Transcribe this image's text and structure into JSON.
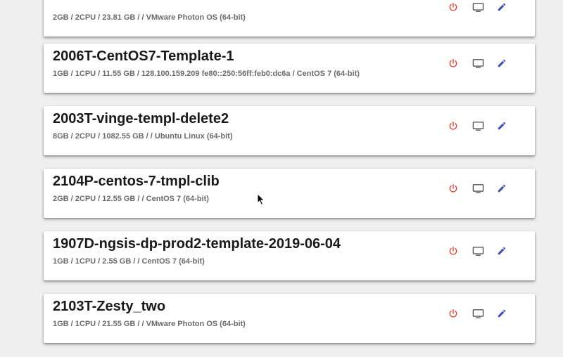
{
  "colors": {
    "power": "#e0433a",
    "console": "#555555",
    "edit": "#3f51b5"
  },
  "icons": {
    "power": "power-icon",
    "console": "monitor-icon",
    "edit": "pencil-icon"
  },
  "vms": [
    {
      "name": "",
      "specs": "2GB / 2CPU / 23.81 GB / / VMware Photon OS (64-bit)"
    },
    {
      "name": "2006T-CentOS7-Template-1",
      "specs": "1GB / 1CPU / 11.55 GB / 128.100.159.209 fe80::250:56ff:feb0:dc6a / CentOS 7 (64-bit)"
    },
    {
      "name": "2003T-vinge-templ-delete2",
      "specs": "8GB / 2CPU / 1082.55 GB / / Ubuntu Linux (64-bit)"
    },
    {
      "name": "2104P-centos-7-tmpl-clib",
      "specs": "2GB / 2CPU / 12.55 GB / / CentOS 7 (64-bit)"
    },
    {
      "name": "1907D-ngsis-dp-prod2-template-2019-06-04",
      "specs": "1GB / 1CPU / 2.55 GB / / CentOS 7 (64-bit)"
    },
    {
      "name": "2103T-Zesty_two",
      "specs": "1GB / 1CPU / 21.55 GB / / VMware Photon OS (64-bit)"
    }
  ]
}
